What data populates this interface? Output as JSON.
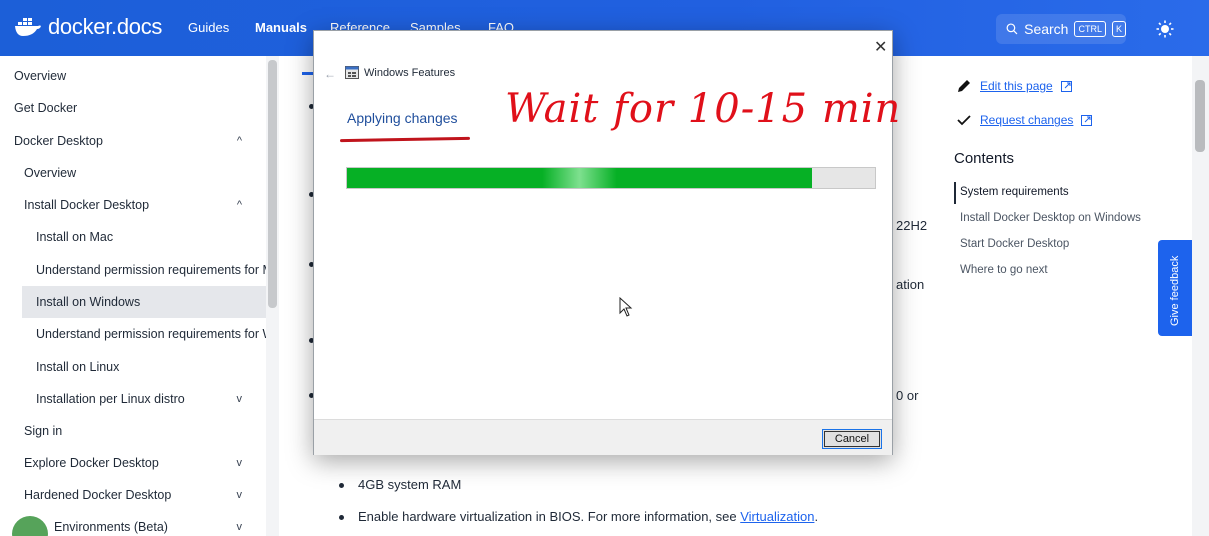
{
  "header": {
    "logo_text": "docker.docs",
    "nav": [
      {
        "label": "Guides",
        "active": false
      },
      {
        "label": "Manuals",
        "active": true
      },
      {
        "label": "Reference",
        "active": false
      },
      {
        "label": "Samples",
        "active": false
      },
      {
        "label": "FAQ",
        "active": false
      }
    ],
    "search_label": "Search",
    "search_kbd_1": "CTRL",
    "search_kbd_2": "K"
  },
  "sidebar": {
    "items": [
      {
        "label": "Overview",
        "chevron": ""
      },
      {
        "label": "Get Docker",
        "chevron": ""
      },
      {
        "label": "Docker Desktop",
        "chevron": "^"
      },
      {
        "label": "Overview",
        "chevron": ""
      },
      {
        "label": "Install Docker Desktop",
        "chevron": "^"
      },
      {
        "label": "Install on Mac",
        "chevron": ""
      },
      {
        "label": "Understand permission requirements for Ma",
        "chevron": ""
      },
      {
        "label": "Install on Windows",
        "chevron": "",
        "active": true
      },
      {
        "label": "Understand permission requirements for Wi",
        "chevron": ""
      },
      {
        "label": "Install on Linux",
        "chevron": ""
      },
      {
        "label": "Installation per Linux distro",
        "chevron": "v"
      },
      {
        "label": "Sign in",
        "chevron": ""
      },
      {
        "label": "Explore Docker Desktop",
        "chevron": "v"
      },
      {
        "label": "Hardened Docker Desktop",
        "chevron": "v"
      },
      {
        "label": "Environments (Beta)",
        "chevron": "v"
      }
    ]
  },
  "main": {
    "fragment_22h2": "22H2",
    "fragment_ation": "ation",
    "fragment_0or": "0 or",
    "bullet_ram": "4GB system RAM",
    "bullet_virt_prefix": "Enable hardware virtualization in BIOS. For more information, see ",
    "bullet_virt_link": "Virtualization",
    "bullet_virt_suffix": "."
  },
  "rail": {
    "edit_label": "Edit this page",
    "request_label": "Request changes",
    "contents_title": "Contents",
    "toc": [
      {
        "label": "System requirements",
        "active": true
      },
      {
        "label": "Install Docker Desktop on Windows",
        "active": false
      },
      {
        "label": "Start Docker Desktop",
        "active": false
      },
      {
        "label": "Where to go next",
        "active": false
      }
    ],
    "feedback_label": "Give feedback"
  },
  "dialog": {
    "title": "Windows Features",
    "status": "Applying changes",
    "progress": 0.88,
    "cancel_label": "Cancel"
  },
  "annotation": {
    "text": "Wait for 10-15 min"
  },
  "colors": {
    "header_blue": "#1d63ed",
    "progress_green": "#06b025",
    "annotation_red": "#e0101a"
  }
}
